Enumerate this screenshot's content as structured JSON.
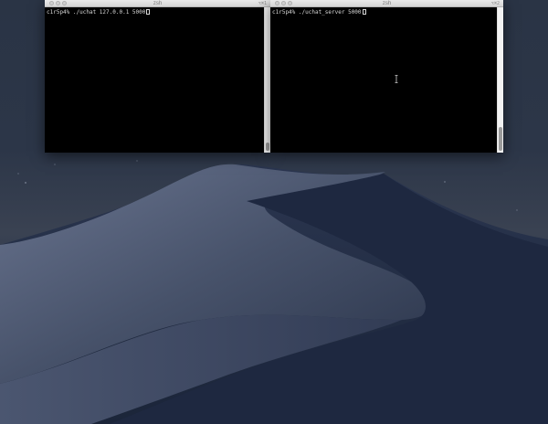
{
  "windows": [
    {
      "title": "zsh",
      "corner_label": "⌥⌘1",
      "prompt_line": "c1r5p4% ./uchat 127.0.0.1 5000"
    },
    {
      "title": "zsh",
      "corner_label": "⌥⌘2",
      "prompt_line": "c1r5p4% ./uchat_server 5000"
    }
  ],
  "colors": {
    "terminal_bg": "#000000",
    "terminal_text": "#d8d8d8",
    "titlebar": "#e0e0e0",
    "sky": "#2b3547",
    "dune_dark": "#1f2a40",
    "dune_light": "#5a6680"
  },
  "icons": {
    "pointer": "ibeam-cursor-icon",
    "window_controls": "traffic-light-icon"
  }
}
